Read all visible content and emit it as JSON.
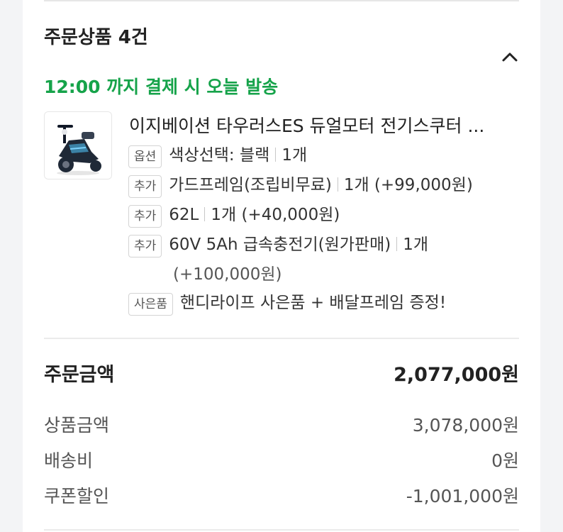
{
  "order": {
    "section_title": "주문상품 4건",
    "delivery_notice": "12:00 까지 결제 시 오늘 발송",
    "collapse_icon": "chevron-up-icon",
    "product": {
      "image_icon": "electric-scooter-image",
      "name": "이지베이션 타우러스ES 듀얼모터 전기스쿠터 ...",
      "options": [
        {
          "badge": "옵션",
          "name": "색상선택: 블랙",
          "detail": "1개"
        },
        {
          "badge": "추가",
          "name": "가드프레임(조립비무료)",
          "detail": "1개 (+99,000원)"
        },
        {
          "badge": "추가",
          "name": "62L",
          "detail": "1개 (+40,000원)"
        },
        {
          "badge": "추가",
          "name": "60V 5Ah 급속충전기(원가판매)",
          "detail": "1개",
          "detail_line2": "(+100,000원)"
        },
        {
          "badge": "사은품",
          "name": "핸디라이프 사은품 + 배달프레임 증정!"
        }
      ]
    }
  },
  "summary": {
    "total_label": "주문금액",
    "total_value": "2,077,000원",
    "lines": [
      {
        "label": "상품금액",
        "value": "3,078,000원"
      },
      {
        "label": "배송비",
        "value": "0원"
      },
      {
        "label": "쿠폰할인",
        "value": "-1,001,000원"
      }
    ]
  },
  "colors": {
    "accent_green": "#16a34a",
    "page_bg": "#f3f4f6",
    "card_bg": "#ffffff"
  }
}
